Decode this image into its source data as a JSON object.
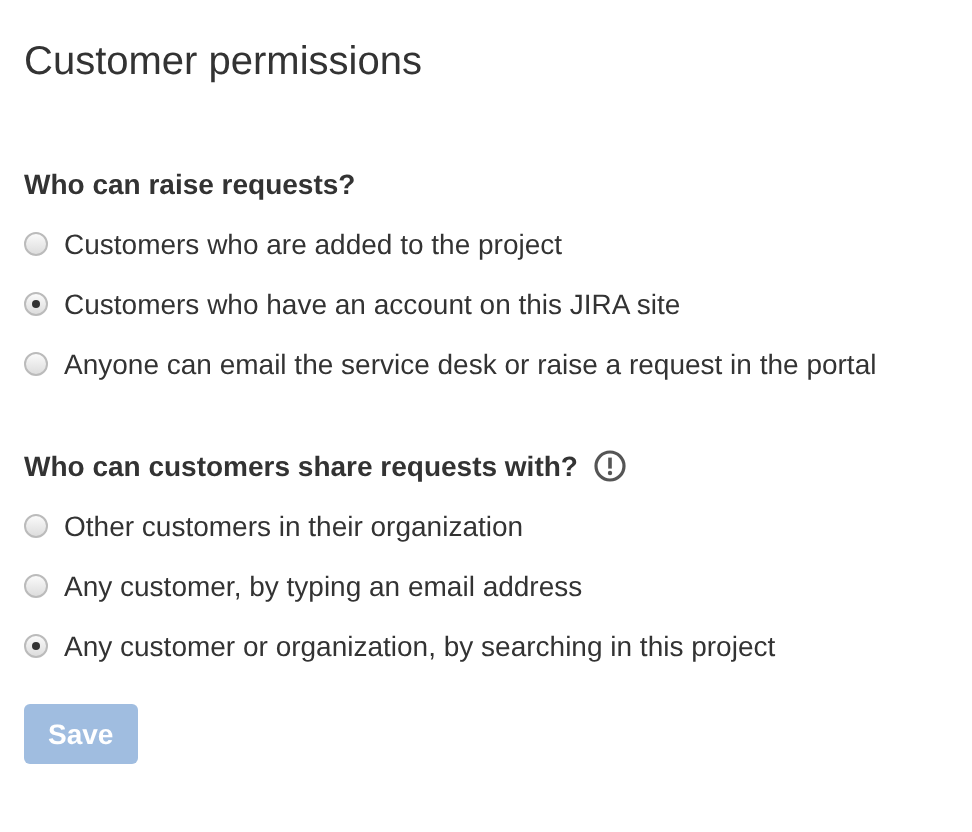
{
  "title": "Customer permissions",
  "groups": [
    {
      "heading": "Who can raise requests?",
      "info_icon": false,
      "options": [
        {
          "label": "Customers who are added to the project",
          "selected": false
        },
        {
          "label": "Customers who have an account on this JIRA site",
          "selected": true
        },
        {
          "label": "Anyone can email the service desk or raise a request in the portal",
          "selected": false
        }
      ]
    },
    {
      "heading": "Who can customers share requests with?",
      "info_icon": true,
      "options": [
        {
          "label": "Other customers in their organization",
          "selected": false
        },
        {
          "label": "Any customer, by typing an email address",
          "selected": false
        },
        {
          "label": "Any customer or organization, by searching in this project",
          "selected": true
        }
      ]
    }
  ],
  "save_button": {
    "label": "Save",
    "disabled": true
  }
}
